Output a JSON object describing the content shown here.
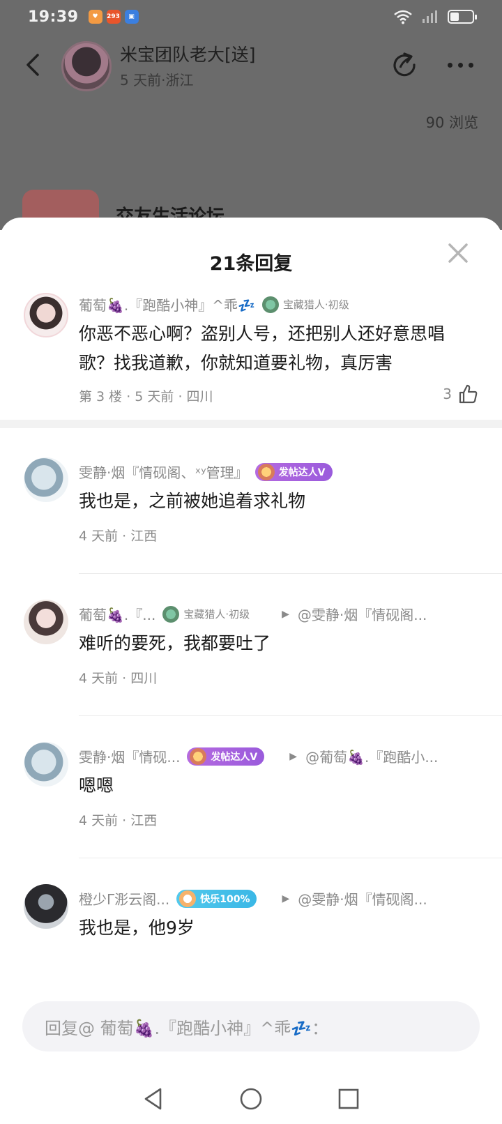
{
  "status_bar": {
    "time": "19:39",
    "app_icons": [
      {
        "name": "heart-app-icon",
        "label": "",
        "color": "#f39a43"
      },
      {
        "name": "app-293-icon",
        "label": "293",
        "color": "#e8552b"
      },
      {
        "name": "blue-app-icon",
        "label": "",
        "color": "#3b7fe0"
      }
    ],
    "battery_level": 0.4
  },
  "post_header": {
    "poster_name": "米宝团队老大[送]",
    "poster_meta": "5 天前·浙江",
    "views": "90 浏览",
    "forum_name": "交友生活论坛"
  },
  "sheet": {
    "title": "21条回复"
  },
  "main_comment": {
    "author": "葡萄🍇.『跑酷小神』^乖💤",
    "badge": "宝藏猎人·初级",
    "text": "你恶不恶心啊？盗别人号，还把别人还好意思唱歌？找我道歉，你就知道要礼物，真厉害",
    "meta": "第 3 楼 · 5 天前 · 四川",
    "likes": "3"
  },
  "replies": [
    {
      "author": "雯静·烟『情砚阁、ˣʸ管理』",
      "badge": "发帖达人V",
      "reply_to": "",
      "text": "我也是，之前被她追着求礼物",
      "meta": "4 天前 · 江西"
    },
    {
      "author": "葡萄🍇.『...",
      "badge": "宝藏猎人·初级",
      "reply_to": "@雯静·烟『情砚阁...",
      "text": "难听的要死，我都要吐了",
      "meta": "4 天前 · 四川"
    },
    {
      "author": "雯静·烟『情砚...",
      "badge": "发帖达人V",
      "reply_to": "@葡萄🍇.『跑酷小...",
      "text": "嗯嗯",
      "meta": "4 天前 · 江西"
    },
    {
      "author": "橙少Γ浵云阁...",
      "badge": "快乐100%",
      "reply_to": "@雯静·烟『情砚阁...",
      "text": "我也是，他9岁",
      "meta": ""
    }
  ],
  "reply_input": {
    "placeholder": "回复@ 葡萄🍇.『跑酷小神』^乖💤："
  }
}
